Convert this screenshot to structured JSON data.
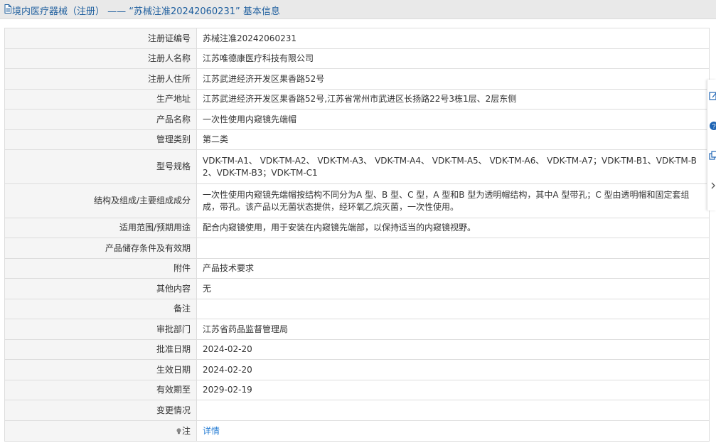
{
  "header": {
    "title": "境内医疗器械（注册） —— “苏械注准20242060231” 基本信息"
  },
  "rows": [
    {
      "label": "注册证编号",
      "value": "苏械注准20242060231"
    },
    {
      "label": "注册人名称",
      "value": "江苏唯德康医疗科技有限公司"
    },
    {
      "label": "注册人住所",
      "value": "江苏武进经济开发区果香路52号"
    },
    {
      "label": "生产地址",
      "value": "江苏武进经济开发区果香路52号,江苏省常州市武进区长扬路22号3栋1层、2层东侧"
    },
    {
      "label": "产品名称",
      "value": "一次性使用内窥镜先端帽"
    },
    {
      "label": "管理类别",
      "value": "第二类"
    },
    {
      "label": "型号规格",
      "value": "VDK-TM-A1、 VDK-TM-A2、 VDK-TM-A3、 VDK-TM-A4、 VDK-TM-A5、 VDK-TM-A6、 VDK-TM-A7；VDK-TM-B1、VDK-TM-B2、VDK-TM-B3；VDK-TM-C1"
    },
    {
      "label": "结构及组成/主要组成成分",
      "value": "一次性使用内窥镜先端帽按结构不同分为A 型、B 型、C 型，A 型和B 型为透明帽结构，其中A 型带孔；C 型由透明帽和固定套组成，带孔。该产品以无菌状态提供，经环氧乙烷灭菌，一次性使用。"
    },
    {
      "label": "适用范围/预期用途",
      "value": "配合内窥镜使用，用于安装在内窥镜先端部，以保持适当的内窥镜视野。"
    },
    {
      "label": "产品储存条件及有效期",
      "value": ""
    },
    {
      "label": "附件",
      "value": "产品技术要求"
    },
    {
      "label": "其他内容",
      "value": "无"
    },
    {
      "label": "备注",
      "value": ""
    },
    {
      "label": "审批部门",
      "value": "江苏省药品监督管理局"
    },
    {
      "label": "批准日期",
      "value": "2024-02-20"
    },
    {
      "label": "生效日期",
      "value": "2024-02-20"
    },
    {
      "label": "有效期至",
      "value": "2029-02-19"
    },
    {
      "label": "变更情况",
      "value": ""
    }
  ],
  "note": {
    "label": "注",
    "link": "详情"
  },
  "icons": {
    "header": "document-icon",
    "note": "lightbulb-icon",
    "sidebar": [
      "edit-icon",
      "help-icon",
      "copy-icon",
      "chevron-right-icon"
    ]
  },
  "colors": {
    "header_bg": "#e9e9e9",
    "title": "#1f5f9e",
    "label_bg": "#f5f5f5",
    "border": "#dddddd",
    "link": "#2a7fd5",
    "accent_blue": "#1e64b4"
  }
}
